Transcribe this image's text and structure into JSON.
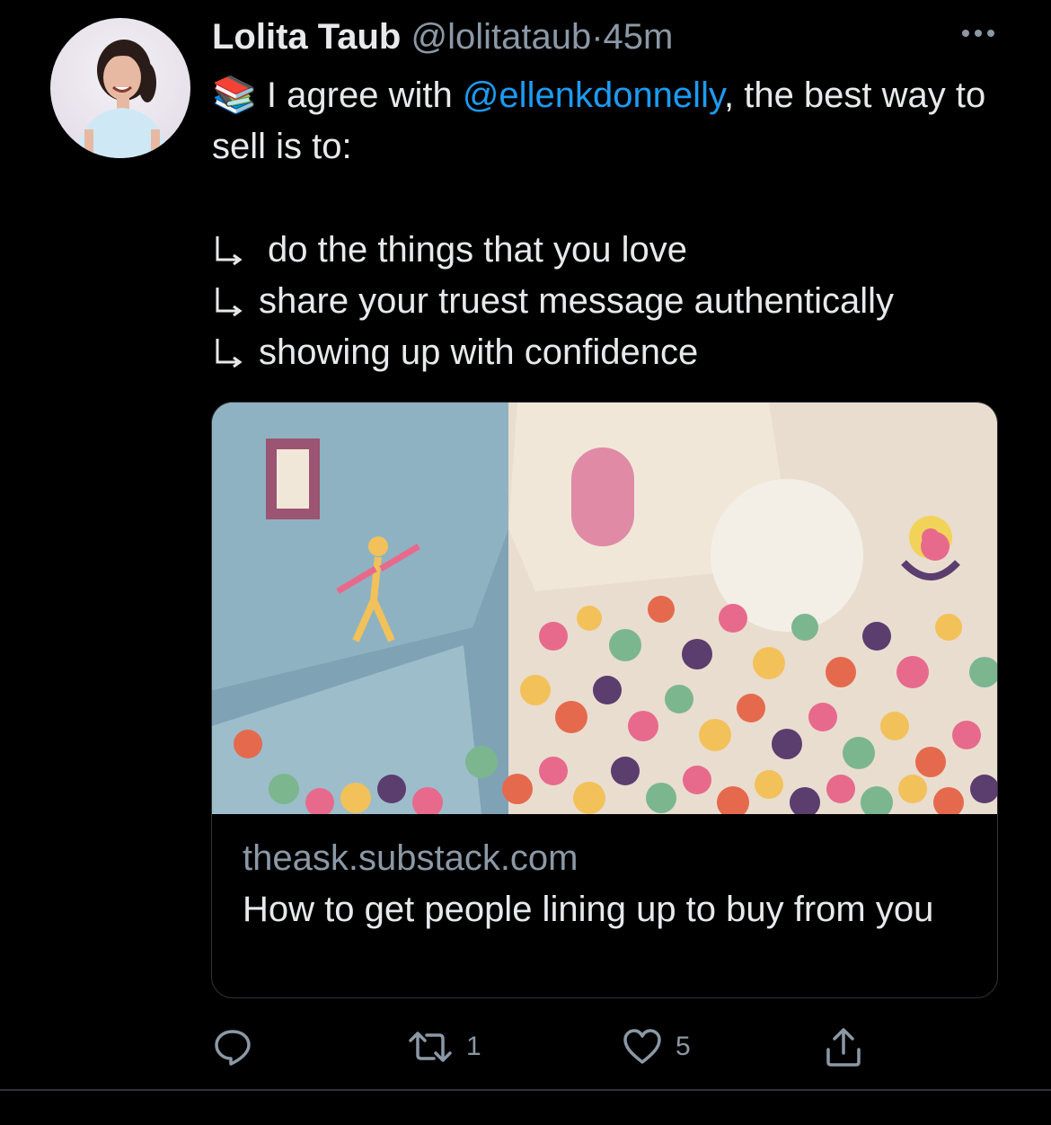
{
  "tweet": {
    "author": {
      "display_name": "Lolita Taub",
      "handle": "@lolitataub",
      "separator": "·",
      "time": "45m"
    },
    "text": {
      "emoji": "📚",
      "intro_before": " I agree with ",
      "mention": "@ellenkdonnelly",
      "intro_after": ", the best way to sell is to:",
      "bullets": [
        "do the things that you love",
        "share your truest message authentically",
        "showing up with confidence"
      ]
    },
    "card": {
      "domain": "theask.substack.com",
      "title": "How to get people lining up to buy from you",
      "image_description_icon": "illustration-crowd-image"
    },
    "actions": {
      "reply_count": "",
      "retweet_count": "1",
      "like_count": "5"
    }
  },
  "colors": {
    "background": "#000000",
    "text": "#e7e9ea",
    "muted": "#8b98a5",
    "link": "#1d9bf0",
    "border": "#2f3336"
  }
}
